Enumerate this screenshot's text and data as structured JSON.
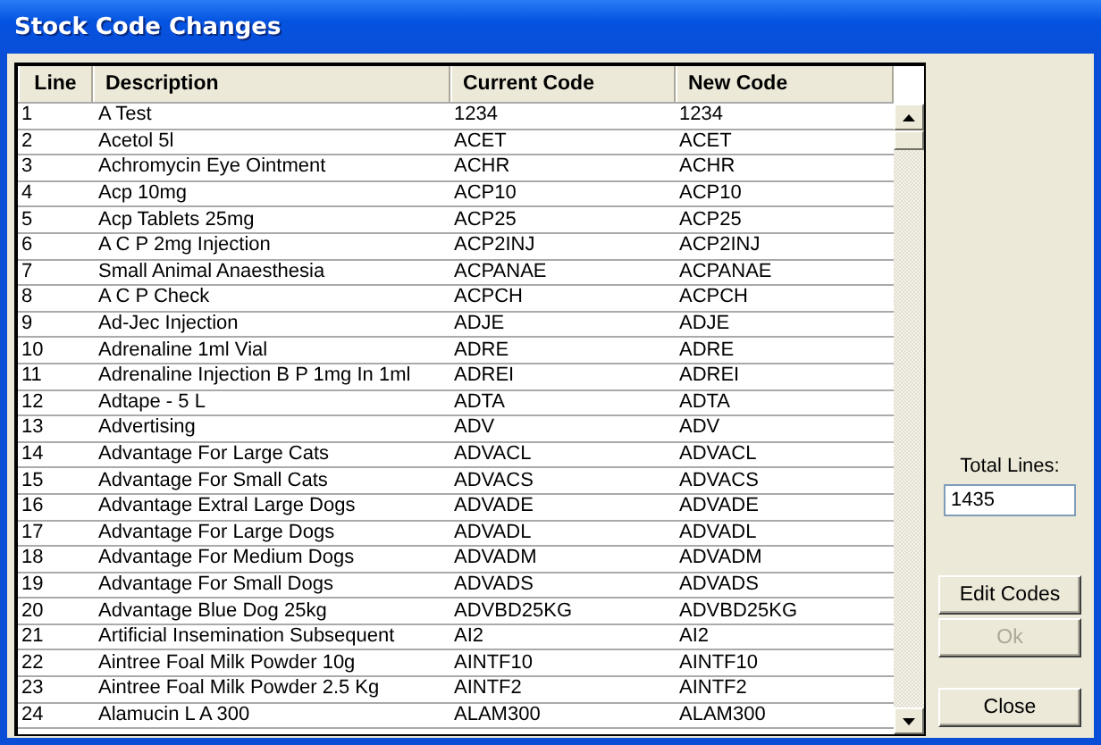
{
  "window": {
    "title": "Stock Code Changes"
  },
  "table": {
    "columns": [
      "Line",
      "Description",
      "Current Code",
      "New Code"
    ],
    "rows": [
      [
        "1",
        "A Test",
        "1234",
        "1234"
      ],
      [
        "2",
        "Acetol 5l",
        "ACET",
        "ACET"
      ],
      [
        "3",
        "Achromycin Eye Ointment",
        "ACHR",
        "ACHR"
      ],
      [
        "4",
        "Acp 10mg",
        "ACP10",
        "ACP10"
      ],
      [
        "5",
        "Acp Tablets 25mg",
        "ACP25",
        "ACP25"
      ],
      [
        "6",
        "A C P 2mg Injection",
        "ACP2INJ",
        "ACP2INJ"
      ],
      [
        "7",
        "Small Animal Anaesthesia",
        "ACPANAE",
        "ACPANAE"
      ],
      [
        "8",
        "A C P Check",
        "ACPCH",
        "ACPCH"
      ],
      [
        "9",
        "Ad-Jec Injection",
        "ADJE",
        "ADJE"
      ],
      [
        "10",
        "Adrenaline 1ml Vial",
        "ADRE",
        "ADRE"
      ],
      [
        "11",
        "Adrenaline Injection B P 1mg In 1ml",
        "ADREI",
        "ADREI"
      ],
      [
        "12",
        "Adtape - 5 L",
        "ADTA",
        "ADTA"
      ],
      [
        "13",
        "Advertising",
        "ADV",
        "ADV"
      ],
      [
        "14",
        "Advantage For Large Cats",
        "ADVACL",
        "ADVACL"
      ],
      [
        "15",
        "Advantage For Small Cats",
        "ADVACS",
        "ADVACS"
      ],
      [
        "16",
        "Advantage Extral Large Dogs",
        "ADVADE",
        "ADVADE"
      ],
      [
        "17",
        "Advantage For Large Dogs",
        "ADVADL",
        "ADVADL"
      ],
      [
        "18",
        "Advantage For Medium Dogs",
        "ADVADM",
        "ADVADM"
      ],
      [
        "19",
        "Advantage For Small Dogs",
        "ADVADS",
        "ADVADS"
      ],
      [
        "20",
        "Advantage Blue Dog 25kg",
        "ADVBD25KG",
        "ADVBD25KG"
      ],
      [
        "21",
        "Artificial Insemination Subsequent",
        "AI2",
        "AI2"
      ],
      [
        "22",
        "Aintree Foal Milk Powder 10g",
        "AINTF10",
        "AINTF10"
      ],
      [
        "23",
        "Aintree Foal Milk Powder 2.5 Kg",
        "AINTF2",
        "AINTF2"
      ],
      [
        "24",
        "Alamucin L A 300",
        "ALAM300",
        "ALAM300"
      ]
    ]
  },
  "total_lines": {
    "label": "Total Lines:",
    "value": "1435"
  },
  "buttons": [
    {
      "label": "Edit Codes",
      "disabled": false
    },
    {
      "label": "Ok",
      "disabled": true
    },
    {
      "label": "Close",
      "disabled": false
    }
  ]
}
